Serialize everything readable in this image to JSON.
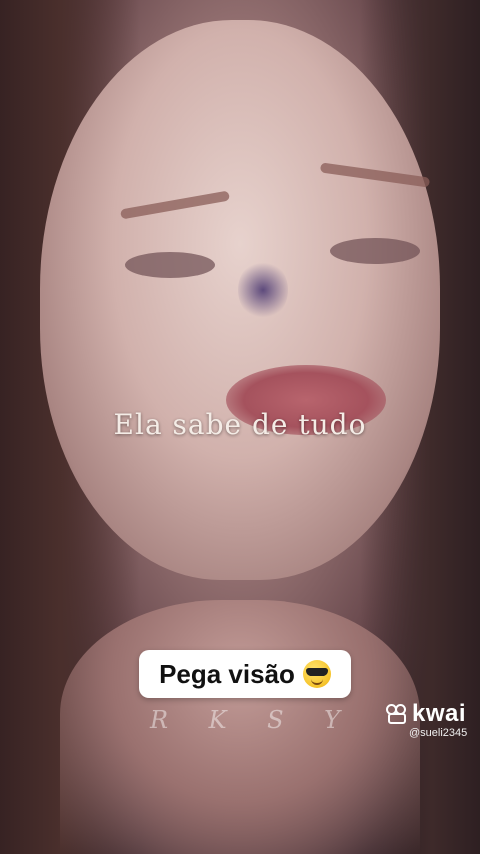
{
  "video": {
    "caption": "Ela sabe de tudo",
    "sticker_text": "Pega visão",
    "sticker_emoji": "smiling-face-with-sunglasses",
    "watermark_letters": [
      "R",
      "K",
      "S",
      "Y"
    ]
  },
  "branding": {
    "app_name": "kwai",
    "username": "@sueli2345"
  }
}
